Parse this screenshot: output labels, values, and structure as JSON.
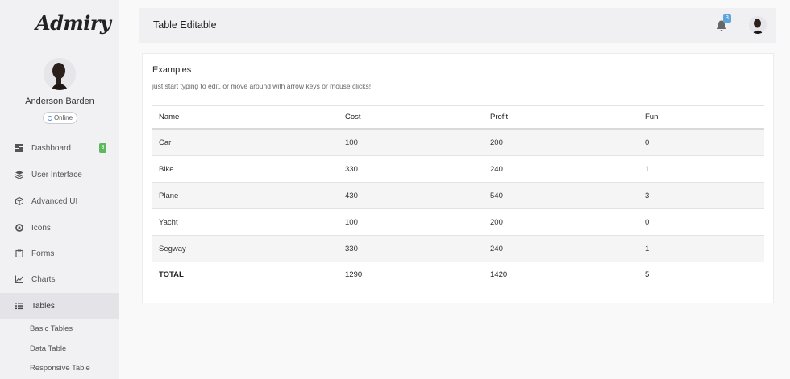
{
  "brand": {
    "logo_text": "Admiry"
  },
  "user": {
    "name": "Anderson Barden",
    "status": "Online"
  },
  "sidebar": {
    "items": [
      {
        "label": "Dashboard",
        "icon": "dashboard-icon",
        "badge": "8"
      },
      {
        "label": "User Interface",
        "icon": "layers-icon"
      },
      {
        "label": "Advanced UI",
        "icon": "cube-icon"
      },
      {
        "label": "Icons",
        "icon": "circle-icon"
      },
      {
        "label": "Forms",
        "icon": "clipboard-icon"
      },
      {
        "label": "Charts",
        "icon": "line-chart-icon"
      },
      {
        "label": "Tables",
        "icon": "list-icon",
        "active": true
      }
    ],
    "sub_items": [
      "Basic Tables",
      "Data Table",
      "Responsive Table"
    ]
  },
  "header": {
    "title": "Table Editable",
    "notification_count": "3"
  },
  "card": {
    "title": "Examples",
    "subtitle": "just start typing to edit, or move around with arrow keys or mouse clicks!"
  },
  "table": {
    "columns": [
      "Name",
      "Cost",
      "Profit",
      "Fun"
    ],
    "rows": [
      [
        "Car",
        "100",
        "200",
        "0"
      ],
      [
        "Bike",
        "330",
        "240",
        "1"
      ],
      [
        "Plane",
        "430",
        "540",
        "3"
      ],
      [
        "Yacht",
        "100",
        "200",
        "0"
      ],
      [
        "Segway",
        "330",
        "240",
        "1"
      ]
    ],
    "total": [
      "TOTAL",
      "1290",
      "1420",
      "5"
    ]
  },
  "colors": {
    "online": "#4a8fd6",
    "badge_green": "#5cb85c",
    "notification": "#5fa4db",
    "active_bg": "#e4e4e8"
  }
}
